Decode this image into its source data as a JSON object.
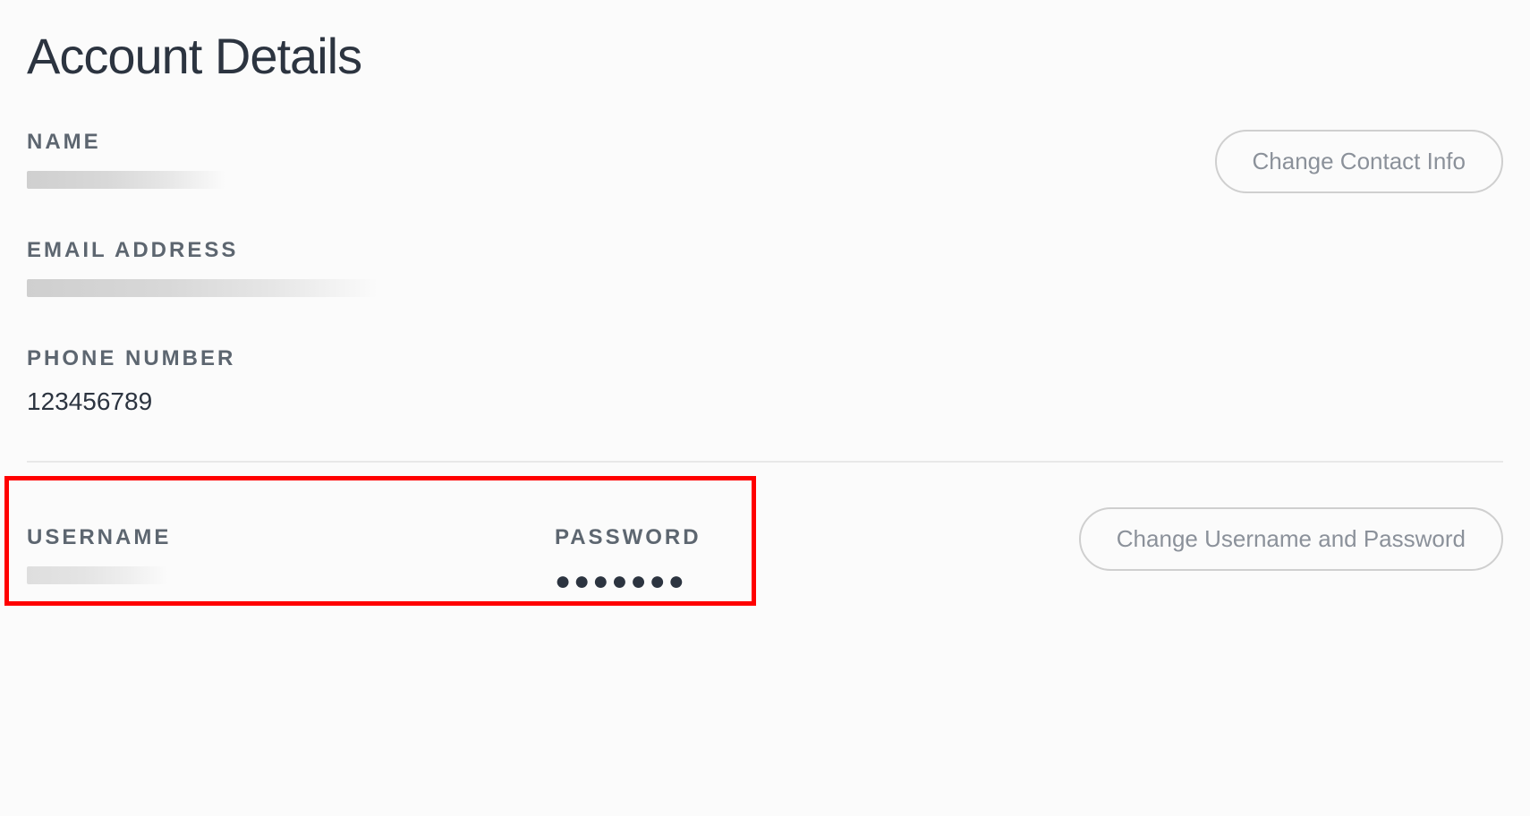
{
  "page": {
    "title": "Account Details"
  },
  "contact": {
    "name_label": "NAME",
    "name_value": "",
    "email_label": "EMAIL ADDRESS",
    "email_value": "",
    "phone_label": "PHONE NUMBER",
    "phone_value": "123456789",
    "change_button": "Change Contact Info"
  },
  "credentials": {
    "username_label": "USERNAME",
    "username_value": "",
    "password_label": "PASSWORD",
    "password_value": "●●●●●●●",
    "change_button": "Change Username and Password"
  }
}
